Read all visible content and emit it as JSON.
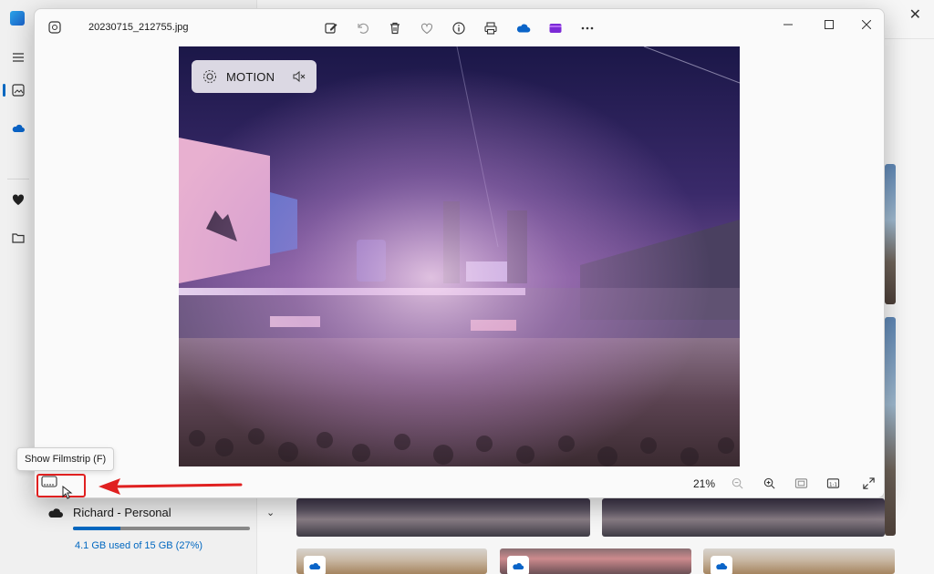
{
  "viewer": {
    "filename": "20230715_212755.jpg",
    "motion_label": "MOTION",
    "zoom_level": "21%",
    "toolbar_icons": [
      "edit-icon",
      "rotate-icon",
      "delete-icon",
      "favorite-icon",
      "info-icon",
      "print-icon",
      "onedrive-icon",
      "clipchamp-icon",
      "more-icon"
    ],
    "bottom_icons": [
      "filmstrip-icon",
      "zoom-out-icon",
      "zoom-in-icon",
      "fit-icon",
      "actual-size-icon",
      "fullscreen-icon"
    ]
  },
  "tooltip": {
    "text": "Show Filmstrip (F)"
  },
  "account": {
    "name": "Richard - Personal",
    "usage": "4.1 GB used of 15 GB (27%)",
    "used_fraction": 0.27
  },
  "colors": {
    "accent": "#0067c0",
    "highlight": "#e02020"
  }
}
